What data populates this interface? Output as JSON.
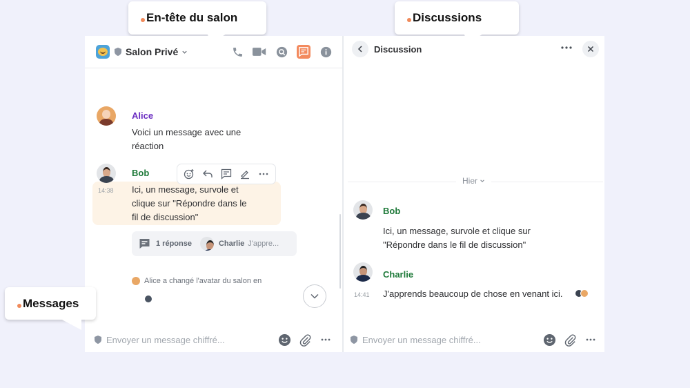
{
  "callouts": {
    "room_header": "En-tête du salon",
    "discussions": "Discussions",
    "messages": "Messages"
  },
  "colors": {
    "page_bg": "#f0f1fb",
    "accent": "#f38a5e",
    "alice": "#6b2ec2",
    "green_sender": "#1f7a3a",
    "highlight_bg": "#fdf3e6"
  },
  "room": {
    "name": "Salon Privé",
    "header_icons": [
      "phone-icon",
      "video-icon",
      "search-icon",
      "threads-icon",
      "info-icon"
    ],
    "messages": [
      {
        "sender": "Alice",
        "body": [
          "Voici un message avec une",
          "réaction"
        ]
      },
      {
        "sender": "Bob",
        "time": "14:38",
        "body": [
          "Ici, un message, survole et",
          "clique sur \"Répondre dans le",
          "fil de discussion\""
        ]
      }
    ],
    "hover_toolbar": [
      "react-icon",
      "reply-icon",
      "thread-icon",
      "edit-icon",
      "more-icon"
    ],
    "thread_summary": {
      "count": "1 réponse",
      "author": "Charlie",
      "preview": "J'appre..."
    },
    "event": "Alice a changé l'avatar du salon en",
    "composer_placeholder": "Envoyer un message chiffré..."
  },
  "thread": {
    "title": "Discussion",
    "date_separator": "Hier",
    "messages": [
      {
        "sender": "Bob",
        "body": [
          "Ici, un message, survole et clique sur",
          "\"Répondre dans le fil de discussion\""
        ]
      },
      {
        "sender": "Charlie",
        "time": "14:41",
        "body": [
          "J'apprends beaucoup de chose en venant ici."
        ]
      }
    ],
    "composer_placeholder": "Envoyer un message chiffré..."
  }
}
